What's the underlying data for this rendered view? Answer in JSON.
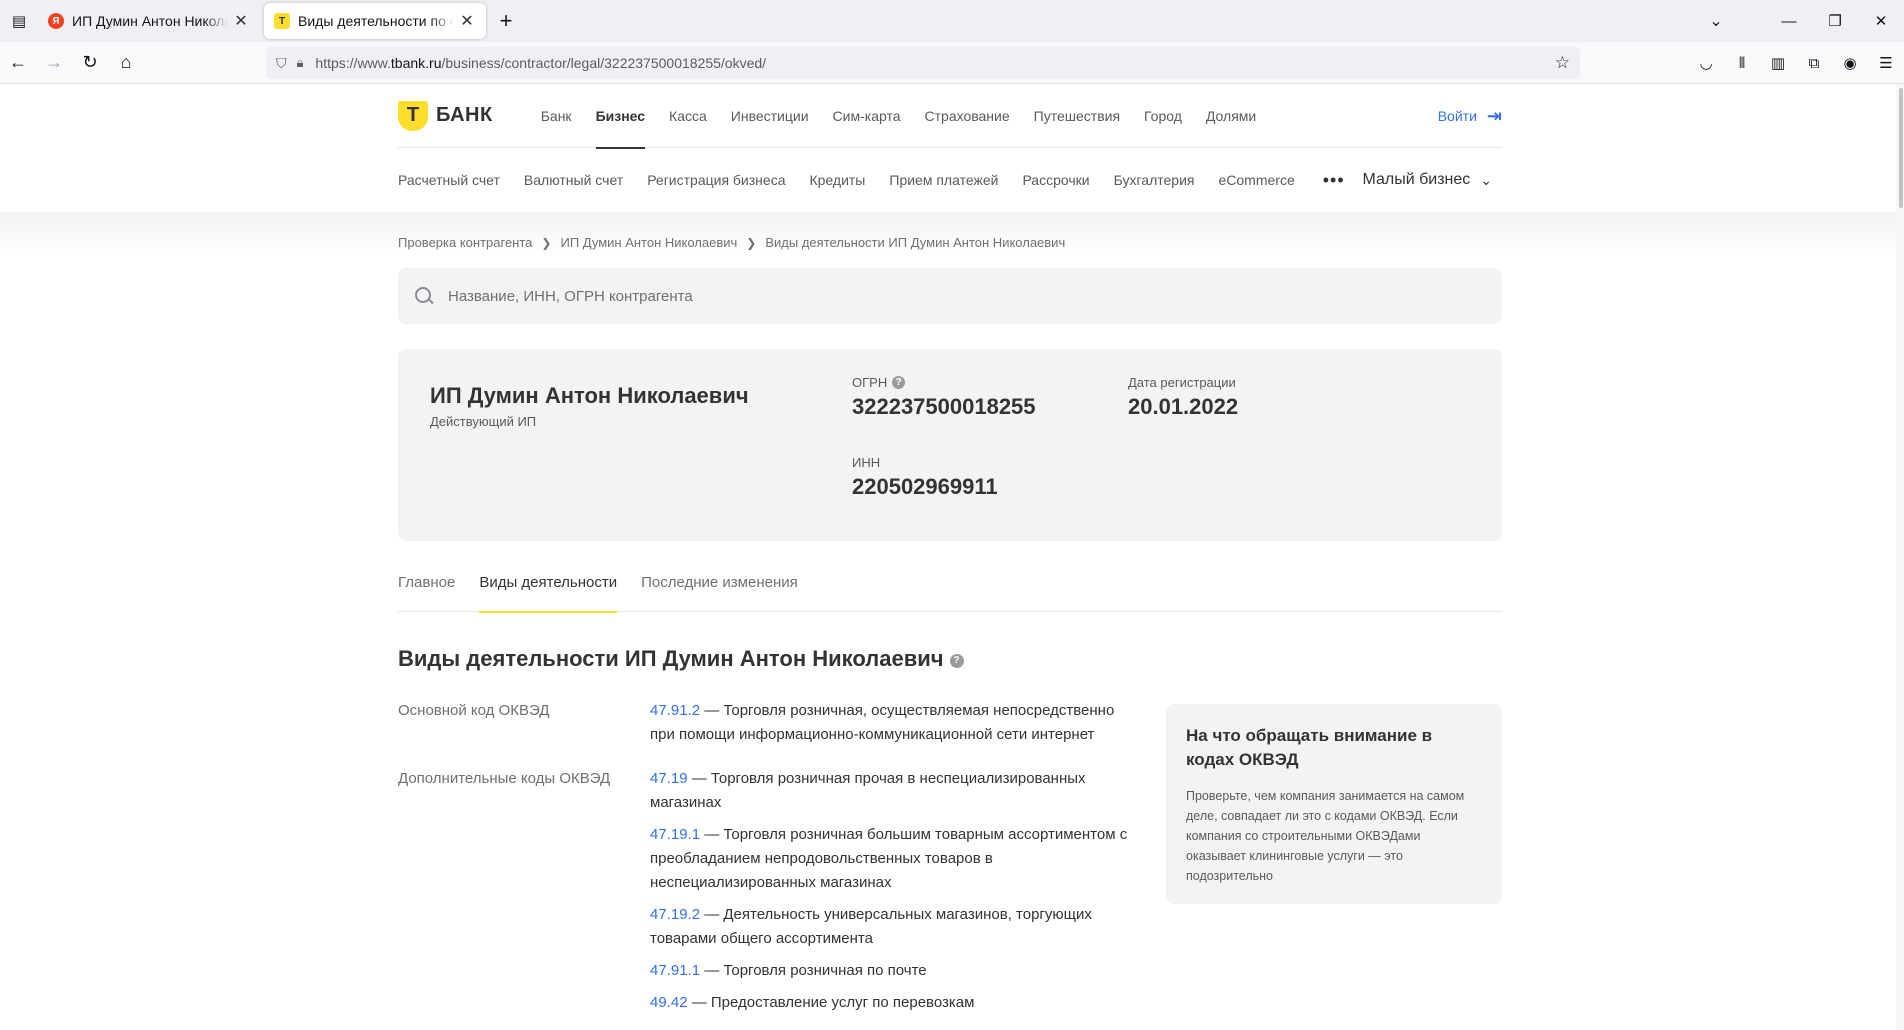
{
  "browser": {
    "tabs": [
      {
        "title": "ИП Думин Антон Николаевич",
        "active": false
      },
      {
        "title": "Виды деятельности по ОКВЭД",
        "active": true
      }
    ],
    "url_prefix": "https://www.",
    "url_domain": "tbank.ru",
    "url_path": "/business/contractor/legal/322237500018255/okved/"
  },
  "header": {
    "logo_letter": "Т",
    "logo_text": "БАНК",
    "main_nav": [
      "Банк",
      "Бизнес",
      "Касса",
      "Инвестиции",
      "Сим-карта",
      "Страхование",
      "Путешествия",
      "Город",
      "Долями"
    ],
    "active_nav": "Бизнес",
    "login_label": "Войти",
    "sub_nav": [
      "Расчетный счет",
      "Валютный счет",
      "Регистрация бизнеса",
      "Кредиты",
      "Прием платежей",
      "Рассрочки",
      "Бухгалтерия",
      "eCommerce"
    ],
    "more_label": "•••",
    "segment_label": "Малый бизнес"
  },
  "breadcrumb": [
    "Проверка контрагента",
    "ИП Думин Антон Николаевич",
    "Виды деятельности ИП Думин Антон Николаевич"
  ],
  "search": {
    "placeholder": "Название, ИНН, ОГРН контрагента"
  },
  "company": {
    "name": "ИП Думин Антон Николаевич",
    "status": "Действующий ИП",
    "ogrn_label": "ОГРН",
    "ogrn": "322237500018255",
    "reg_label": "Дата регистрации",
    "reg_date": "20.01.2022",
    "inn_label": "ИНН",
    "inn": "220502969911"
  },
  "tabs": [
    "Главное",
    "Виды деятельности",
    "Последние изменения"
  ],
  "active_tab": "Виды деятельности",
  "section_title": "Виды деятельности ИП Думин Антон Николаевич",
  "okved": {
    "main_label": "Основной код ОКВЭД",
    "main": [
      {
        "code": "47.91.2",
        "text": " — Торговля розничная, осуществляемая непосредственно при помощи информационно-коммуникационной сети интернет"
      }
    ],
    "extra_label": "Дополнительные коды ОКВЭД",
    "extra": [
      {
        "code": "47.19",
        "text": " — Торговля розничная прочая в неспециализированных магазинах"
      },
      {
        "code": "47.19.1",
        "text": " — Торговля розничная большим товарным ассортиментом с преобладанием непродовольственных товаров в неспециализированных магазинах"
      },
      {
        "code": "47.19.2",
        "text": " — Деятельность универсальных магазинов, торгующих товарами общего ассортимента"
      },
      {
        "code": "47.91.1",
        "text": " — Торговля розничная по почте"
      },
      {
        "code": "49.42",
        "text": " — Предоставление услуг по перевозкам"
      }
    ]
  },
  "aside": {
    "title": "На что обращать внимание в кодах ОКВЭД",
    "text": "Проверьте, чем компания занимается на самом деле, совпадает ли это с кодами ОКВЭД. Если компания со строительными ОКВЭДами оказывает клининговые услуги — это подозрительно"
  },
  "colors": {
    "brand_yellow": "#ffdd2d",
    "link_blue": "#336fee"
  }
}
